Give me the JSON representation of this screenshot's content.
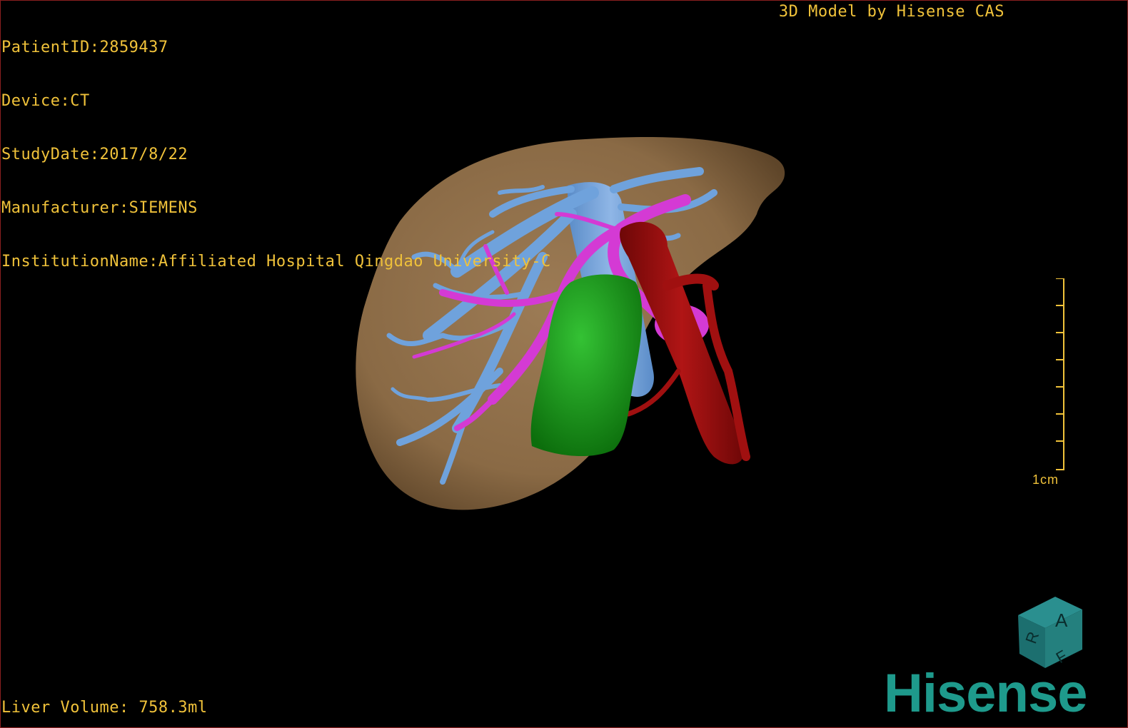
{
  "patient_info": {
    "patient_id": "PatientID:2859437",
    "device": "Device:CT",
    "study_date": "StudyDate:2017/8/22",
    "manufacturer": "Manufacturer:SIEMENS",
    "institution": "InstitutionName:Affiliated Hospital Qingdao University-C"
  },
  "header_title": "3D Model by Hisense CAS",
  "footer": {
    "liver_volume": "Liver Volume: 758.3ml"
  },
  "scale_bar": {
    "label": "1cm"
  },
  "orientation_cube": {
    "face_top": "A",
    "face_left": "R",
    "face_bottom": "F"
  },
  "logo": {
    "text": "Hisense"
  },
  "colors": {
    "hud_text": "#f0c23a",
    "liver": "#8a6a45",
    "hepatic_vein": "#6fa2dc",
    "portal_vein": "#d43ad4",
    "aorta": "#9b0d0d",
    "lesion": "#19a019",
    "brand": "#1e9a8c"
  }
}
